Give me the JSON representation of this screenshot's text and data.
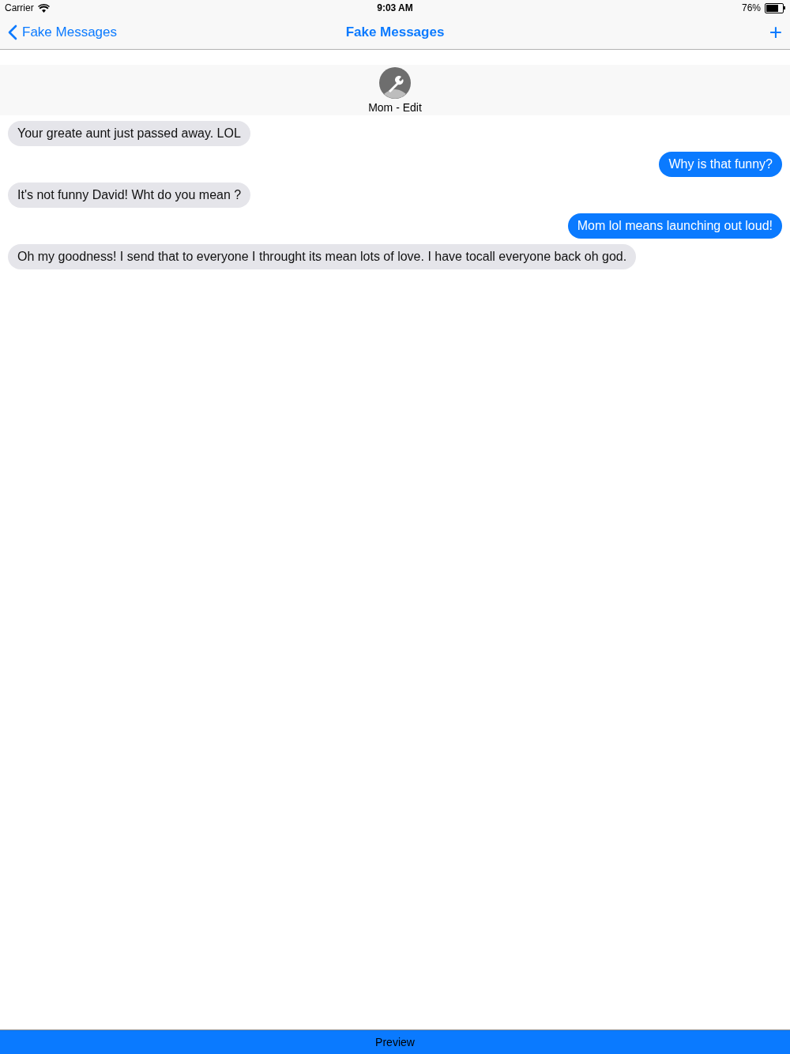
{
  "status_bar": {
    "carrier": "Carrier",
    "time": "9:03 AM",
    "battery": "76%"
  },
  "nav_bar": {
    "back": "Fake Messages",
    "title": "Fake Messages",
    "add": "+"
  },
  "contact": {
    "name": "Mom - Edit"
  },
  "messages": [
    {
      "kind": "received",
      "text": "Your greate aunt just passed away. LOL"
    },
    {
      "kind": "sent",
      "text": "Why is that funny?"
    },
    {
      "kind": "received",
      "text": "It's not funny David! Wht do you mean ?"
    },
    {
      "kind": "sent",
      "text": "Mom lol means launching out loud!"
    },
    {
      "kind": "received",
      "text": "Oh my goodness! I send that to everyone I throught its mean lots of love. I have tocall everyone back oh god."
    }
  ],
  "bottom_bar": {
    "label": "Preview"
  }
}
